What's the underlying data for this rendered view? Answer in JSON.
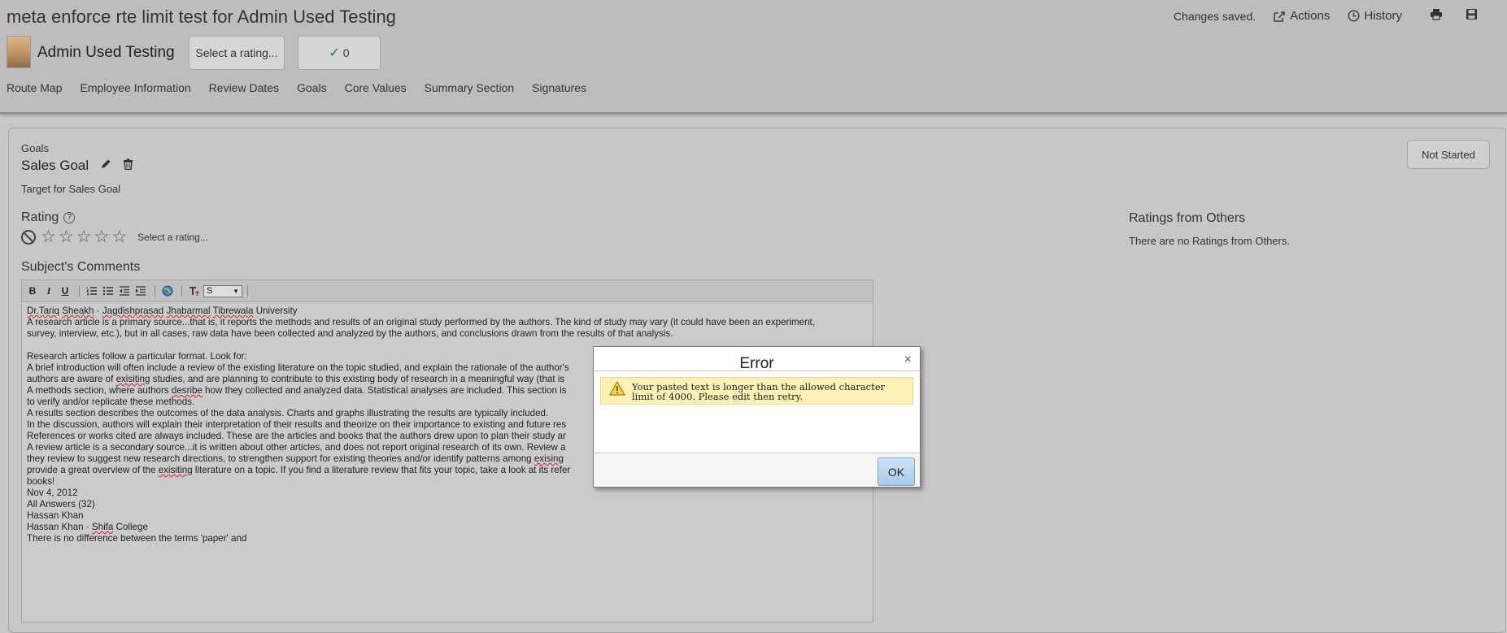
{
  "header": {
    "title": "meta enforce rte limit test for Admin Used Testing",
    "status": "Changes saved.",
    "actions_label": "Actions",
    "history_label": "History",
    "employee_name": "Admin Used Testing",
    "select_rating_label": "Select a rating...",
    "check_count": "0"
  },
  "nav": {
    "items": [
      "Route Map",
      "Employee Information",
      "Review Dates",
      "Goals",
      "Core Values",
      "Summary Section",
      "Signatures"
    ]
  },
  "goal": {
    "section_label": "Goals",
    "title": "Sales Goal",
    "target": "Target for Sales Goal",
    "status_button": "Not Started"
  },
  "rating": {
    "heading": "Rating",
    "help_icon": "?",
    "select_label": "Select a rating..."
  },
  "others": {
    "heading": "Ratings from Others",
    "text": "There are no Ratings from Others."
  },
  "comments": {
    "heading": "Subject's Comments",
    "toolbar": {
      "bold": "B",
      "italic": "I",
      "underline": "U",
      "font_size": "S"
    },
    "body": {
      "line1_a": "Dr.Tariq",
      "line1_b": "Sheakh",
      "line1_c": " · ",
      "line1_d": "Jagdishprasad",
      "line1_e": " ",
      "line1_f": "Jhabarmal",
      "line1_g": " ",
      "line1_h": "Tibrewala",
      "line1_i": " University",
      "line2": "A research article is a primary source...that is, it reports the methods and results of an original study performed by the authors. The kind of study may vary (it could have been an experiment,",
      "line3": "survey, interview, etc.), but in all cases, raw data have been collected and analyzed by the authors, and conclusions drawn from the results of that analysis.",
      "line4": "Research articles follow a particular format. Look for:",
      "line5": "A brief introduction will often include a review of the existing literature on the topic studied, and explain the rationale of the author's",
      "line6_a": "authors are aware of ",
      "line6_b": "exisiting",
      "line6_c": " studies, and are planning to contribute to this existing body of research in a meaningful way (that is",
      "line7_a": "A methods section, where authors ",
      "line7_b": "desribe",
      "line7_c": " how they collected and analyzed data. Statistical analyses are included. This section is",
      "line8": "to verify and/or replicate these methods.",
      "line9": "A results section describes the outcomes of the data analysis. Charts and graphs illustrating the results are typically included.",
      "line10": "In the discussion, authors will explain their interpretation of their results and theorize on their importance to existing and future res",
      "line11": "References or works cited are always included. These are the articles and books that the authors drew upon to plan their study ar",
      "line12": "A review article is a secondary source...it is written about other articles, and does not report original research of its own. Review a",
      "line13_a": "they review to suggest new research directions, to strengthen support for existing theories and/or identify patterns among ",
      "line13_b": "exising",
      "line14_a": "provide a great overview of the ",
      "line14_b": "exisiting",
      "line14_c": " literature on a topic. If you find a literature review that fits your topic, take a look at its refer",
      "line15": "books!",
      "line16": " Nov 4, 2012",
      "line17": "All Answers (32)",
      "line18": " Hassan Khan",
      "line19_a": "Hassan Khan · ",
      "line19_b": "Shifa",
      "line19_c": " College",
      "line20": "There is no difference between the terms 'paper' and"
    }
  },
  "dialog": {
    "title": "Error",
    "close": "×",
    "message": "Your pasted text is longer than the allowed character limit of 4000. Please edit then retry.",
    "ok_label": "OK"
  },
  "colors": {
    "header_bg": "#bdbdbd",
    "page_bg": "#c8c8c8",
    "warning_bg": "#fbf1b5",
    "ok_button": "#b8d6f0"
  }
}
